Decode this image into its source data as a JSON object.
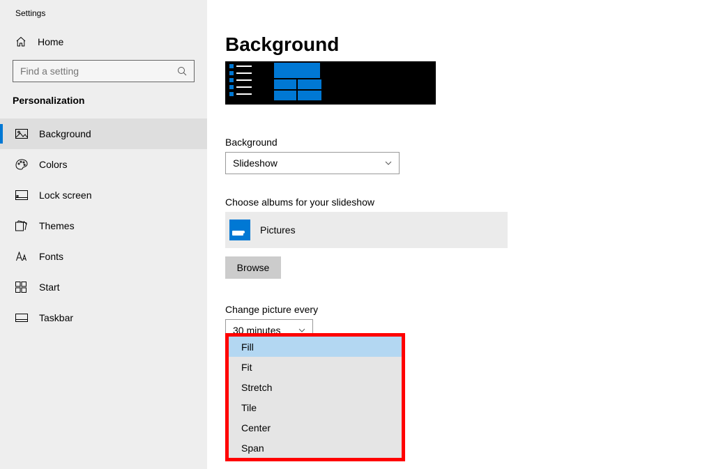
{
  "sidebar": {
    "app_title": "Settings",
    "home_label": "Home",
    "search_placeholder": "Find a setting",
    "section_header": "Personalization",
    "items": [
      {
        "label": "Background",
        "icon": "picture-icon",
        "selected": true
      },
      {
        "label": "Colors",
        "icon": "palette-icon",
        "selected": false
      },
      {
        "label": "Lock screen",
        "icon": "lock-screen-icon",
        "selected": false
      },
      {
        "label": "Themes",
        "icon": "themes-icon",
        "selected": false
      },
      {
        "label": "Fonts",
        "icon": "fonts-icon",
        "selected": false
      },
      {
        "label": "Start",
        "icon": "start-icon",
        "selected": false
      },
      {
        "label": "Taskbar",
        "icon": "taskbar-icon",
        "selected": false
      }
    ]
  },
  "main": {
    "page_title": "Background",
    "background_label": "Background",
    "background_select_value": "Slideshow",
    "albums_label": "Choose albums for your slideshow",
    "album_name": "Pictures",
    "browse_label": "Browse",
    "change_every_label": "Change picture every",
    "change_every_value": "30 minutes"
  },
  "fit_dropdown": {
    "options": [
      {
        "label": "Fill",
        "selected": true
      },
      {
        "label": "Fit",
        "selected": false
      },
      {
        "label": "Stretch",
        "selected": false
      },
      {
        "label": "Tile",
        "selected": false
      },
      {
        "label": "Center",
        "selected": false
      },
      {
        "label": "Span",
        "selected": false
      }
    ]
  },
  "colors": {
    "accent": "#0078d4",
    "highlight": "#b3d7f2",
    "annotation": "#ff0000"
  }
}
